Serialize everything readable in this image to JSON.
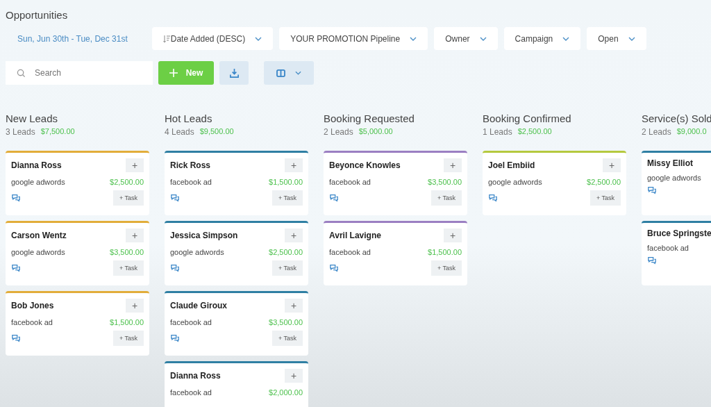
{
  "title": "Opportunities",
  "filters": {
    "date_range": "Sun, Jun 30th - Tue, Dec 31st",
    "dropdowns": [
      {
        "label": "Date Added (DESC)",
        "kind": "sort"
      },
      {
        "label": "YOUR PROMOTION Pipeline",
        "kind": "plain"
      },
      {
        "label": "Owner",
        "kind": "plain"
      },
      {
        "label": "Campaign",
        "kind": "plain"
      },
      {
        "label": "Open",
        "kind": "plain"
      }
    ]
  },
  "toolbar": {
    "search": {
      "placeholder": "Search"
    },
    "new_button": "New"
  },
  "columns": [
    {
      "name": "New Leads",
      "count": "3 Leads",
      "total": "$7,500.00",
      "color": "#e2ad3a",
      "cards": [
        {
          "name": "Dianna Ross",
          "source": "google adwords",
          "value": "$2,500.00",
          "add": "+",
          "task": "+ Task",
          "chat": true
        },
        {
          "name": "Carson Wentz",
          "source": "google adwords",
          "value": "$3,500.00",
          "add": "+",
          "task": "+ Task",
          "chat": true
        },
        {
          "name": "Bob Jones",
          "source": "facebook ad",
          "value": "$1,500.00",
          "add": "+",
          "task": "+ Task",
          "chat": true
        }
      ]
    },
    {
      "name": "Hot Leads",
      "count": "4 Leads",
      "total": "$9,500.00",
      "color": "#2f7fa3",
      "cards": [
        {
          "name": "Rick Ross",
          "source": "facebook ad",
          "value": "$1,500.00",
          "add": "+",
          "task": "+ Task",
          "chat": true
        },
        {
          "name": "Jessica Simpson",
          "source": "google adwords",
          "value": "$2,500.00",
          "add": "+",
          "task": "+ Task",
          "chat": true
        },
        {
          "name": "Claude Giroux",
          "source": "facebook ad",
          "value": "$3,500.00",
          "add": "+",
          "task": "+ Task",
          "chat": true
        },
        {
          "name": "Dianna Ross",
          "source": "facebook ad",
          "value": "$2,000.00",
          "add": "+",
          "chat": false
        }
      ]
    },
    {
      "name": "Booking Requested",
      "count": "2 Leads",
      "total": "$5,000.00",
      "color": "#9b7fc2",
      "cards": [
        {
          "name": "Beyonce Knowles",
          "source": "facebook ad",
          "value": "$3,500.00",
          "add": "+",
          "task": "+ Task",
          "chat": true
        },
        {
          "name": "Avril Lavigne",
          "source": "facebook ad",
          "value": "$1,500.00",
          "add": "+",
          "task": "+ Task",
          "chat": true
        }
      ]
    },
    {
      "name": "Booking Confirmed",
      "count": "1 Leads",
      "total": "$2,500.00",
      "color": "#b5c93f",
      "cards": [
        {
          "name": "Joel Embiid",
          "source": "google adwords",
          "value": "$2,500.00",
          "add": "+",
          "task": "+ Task",
          "chat": true
        }
      ]
    },
    {
      "name": "Service(s) Sold",
      "count": "2 Leads",
      "total": "$9,000.0",
      "color": "#2f7fa3",
      "cards": [
        {
          "name": "Missy Elliot",
          "source": "google adwords",
          "chat": true
        },
        {
          "name": "Bruce Springste",
          "source": "facebook ad",
          "chat": true
        }
      ]
    }
  ]
}
